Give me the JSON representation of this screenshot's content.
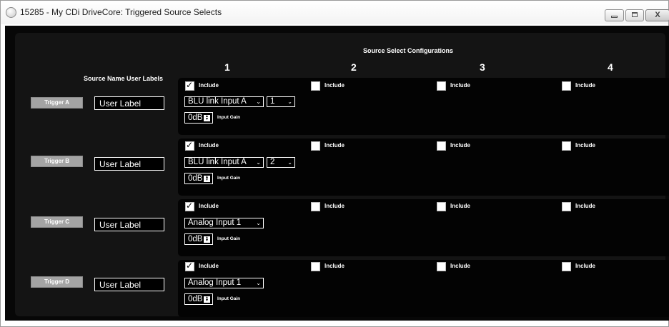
{
  "window": {
    "title": "15285 - My CDi DriveCore: Triggered Source Selects",
    "close_label": "X"
  },
  "header": {
    "config_title": "Source Select Configurations",
    "columns": [
      "1",
      "2",
      "3",
      "4"
    ],
    "source_name_label": "Source Name User Labels"
  },
  "rows": [
    {
      "trigger": "Trigger A",
      "user_label": "User Label",
      "include": [
        true,
        false,
        false,
        false
      ],
      "include_label": "Include",
      "source": "BLU link Input A",
      "channel": "1",
      "gain": "0dB",
      "gain_label": "Input Gain"
    },
    {
      "trigger": "Trigger B",
      "user_label": "User Label",
      "include": [
        true,
        false,
        false,
        false
      ],
      "include_label": "Include",
      "source": "BLU link Input A",
      "channel": "2",
      "gain": "0dB",
      "gain_label": "Input Gain"
    },
    {
      "trigger": "Trigger C",
      "user_label": "User Label",
      "include": [
        true,
        false,
        false,
        false
      ],
      "include_label": "Include",
      "source": "Analog Input 1",
      "channel": null,
      "gain": "0dB",
      "gain_label": "Input Gain"
    },
    {
      "trigger": "Trigger D",
      "user_label": "User Label",
      "include": [
        true,
        false,
        false,
        false
      ],
      "include_label": "Include",
      "source": "Analog Input 1",
      "channel": null,
      "gain": "0dB",
      "gain_label": "Input Gain"
    }
  ],
  "colors": {
    "background": "#070707",
    "trigger_button": "#a4a4a4",
    "text": "#ffffff"
  }
}
